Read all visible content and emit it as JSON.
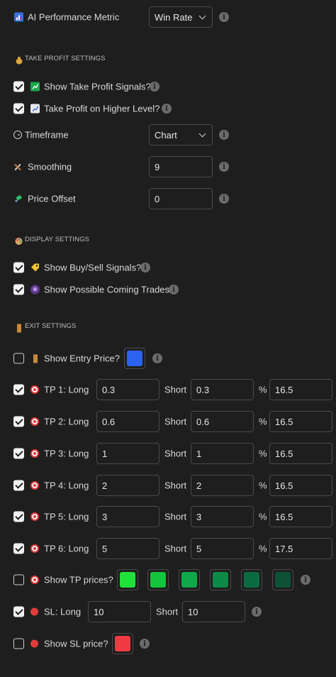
{
  "ai_metric": {
    "label": "AI Performance Metric",
    "value": "Win Rate"
  },
  "take_profit_section": {
    "title": "TAKE PROFIT SETTINGS"
  },
  "show_tp_signals": {
    "label": "Show Take Profit Signals?",
    "checked": true
  },
  "tp_higher_level": {
    "label": "Take Profit on Higher Level?",
    "checked": true
  },
  "timeframe": {
    "label": "Timeframe",
    "value": "Chart"
  },
  "smoothing": {
    "label": "Smoothing",
    "value": "9"
  },
  "price_offset": {
    "label": "Price Offset",
    "value": "0"
  },
  "display_section": {
    "title": "DISPLAY SETTINGS"
  },
  "show_buy_sell": {
    "label": "Show Buy/Sell Signals?",
    "checked": true
  },
  "show_coming_trades": {
    "label": "Show Possible Coming Trades?",
    "checked": true
  },
  "exit_section": {
    "title": "EXIT SETTINGS"
  },
  "show_entry_price": {
    "label": "Show Entry Price?",
    "checked": false,
    "color": "#2b62f0"
  },
  "tp_rows": [
    {
      "label": "TP 1: Long",
      "long": "0.3",
      "short_label": "Short",
      "short": "0.3",
      "pct_label": "%",
      "pct": "16.5",
      "checked": true
    },
    {
      "label": "TP 2: Long",
      "long": "0.6",
      "short_label": "Short",
      "short": "0.6",
      "pct_label": "%",
      "pct": "16.5",
      "checked": true
    },
    {
      "label": "TP 3: Long",
      "long": "1",
      "short_label": "Short",
      "short": "1",
      "pct_label": "%",
      "pct": "16.5",
      "checked": true
    },
    {
      "label": "TP 4: Long",
      "long": "2",
      "short_label": "Short",
      "short": "2",
      "pct_label": "%",
      "pct": "16.5",
      "checked": true
    },
    {
      "label": "TP 5: Long",
      "long": "3",
      "short_label": "Short",
      "short": "3",
      "pct_label": "%",
      "pct": "16.5",
      "checked": true
    },
    {
      "label": "TP 6: Long",
      "long": "5",
      "short_label": "Short",
      "short": "5",
      "pct_label": "%",
      "pct": "17.5",
      "checked": true
    }
  ],
  "show_tp_prices": {
    "label": "Show TP prices?",
    "checked": false,
    "colors": [
      "#22e03a",
      "#14c43a",
      "#10a84a",
      "#0c8a46",
      "#0b6b40",
      "#0d5236"
    ]
  },
  "stop_loss": {
    "label": "SL: Long",
    "long": "10",
    "short_label": "Short",
    "short": "10",
    "checked": true
  },
  "show_sl_price": {
    "label": "Show SL price?",
    "checked": false,
    "color": "#f03a44"
  },
  "icons": {
    "info": "i"
  }
}
